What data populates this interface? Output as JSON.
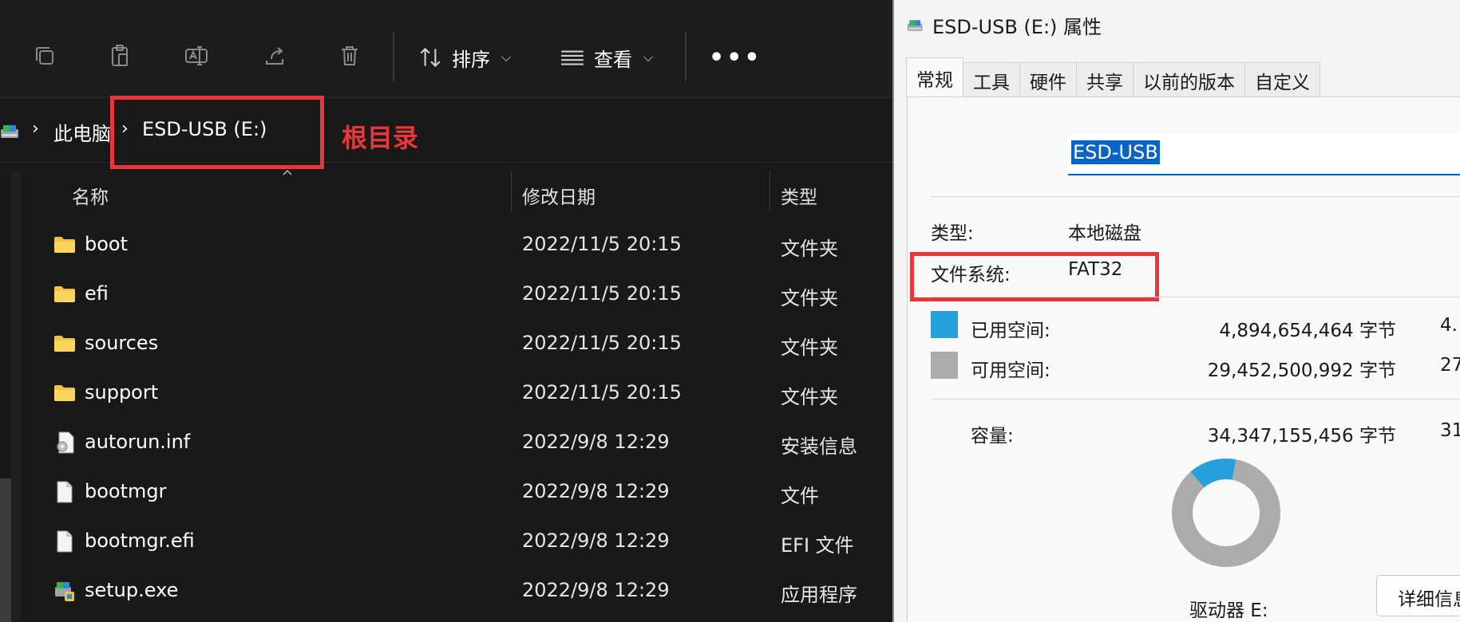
{
  "explorer": {
    "toolbar": {
      "sort_label": "排序",
      "view_label": "查看",
      "more_label": "•••"
    },
    "breadcrumb": {
      "this_pc": "此电脑",
      "drive": "ESD-USB (E:)"
    },
    "annotation": {
      "root_label": "根目录",
      "color": "#e8373a"
    },
    "columns": {
      "name": "名称",
      "modified": "修改日期",
      "type": "类型"
    },
    "files": [
      {
        "name": "boot",
        "date": "2022/11/5 20:15",
        "type": "文件夹",
        "icon": "folder-icon"
      },
      {
        "name": "efi",
        "date": "2022/11/5 20:15",
        "type": "文件夹",
        "icon": "folder-icon"
      },
      {
        "name": "sources",
        "date": "2022/11/5 20:15",
        "type": "文件夹",
        "icon": "folder-icon"
      },
      {
        "name": "support",
        "date": "2022/11/5 20:15",
        "type": "文件夹",
        "icon": "folder-icon"
      },
      {
        "name": "autorun.inf",
        "date": "2022/9/8 12:29",
        "type": "安装信息",
        "icon": "settings-file-icon"
      },
      {
        "name": "bootmgr",
        "date": "2022/9/8 12:29",
        "type": "文件",
        "icon": "file-icon"
      },
      {
        "name": "bootmgr.efi",
        "date": "2022/9/8 12:29",
        "type": "EFI 文件",
        "icon": "file-icon"
      },
      {
        "name": "setup.exe",
        "date": "2022/9/8 12:29",
        "type": "应用程序",
        "icon": "setup-exe-icon"
      }
    ]
  },
  "dialog": {
    "title": "ESD-USB (E:) 属性",
    "tabs": [
      "常规",
      "工具",
      "硬件",
      "共享",
      "以前的版本",
      "自定义"
    ],
    "active_tab": "常规",
    "volume_label": "ESD-USB",
    "type_label": "类型:",
    "type_value": "本地磁盘",
    "fs_label": "文件系统:",
    "fs_value": "FAT32",
    "used_label": "已用空间:",
    "used_bytes": "4,894,654,464 字节",
    "used_short": "4.",
    "free_label": "可用空间:",
    "free_bytes": "29,452,500,992 字节",
    "free_short": "27",
    "capacity_label": "容量:",
    "capacity_bytes": "34,347,155,456 字节",
    "capacity_short": "31",
    "drive_label": "驱动器 E:",
    "details_button": "详细信息",
    "used_fraction": 0.1425,
    "used_color": "#26a0da",
    "free_color": "#ababab"
  }
}
